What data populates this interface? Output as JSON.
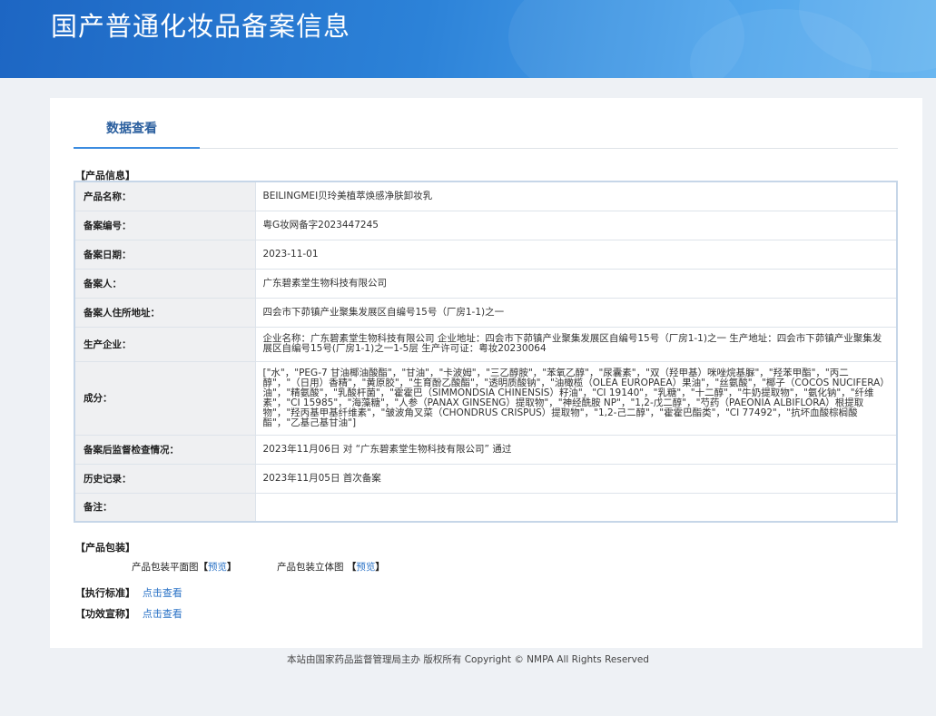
{
  "header": {
    "title": "国产普通化妆品备案信息"
  },
  "tabs": [
    {
      "label": "数据查看"
    }
  ],
  "product_info": {
    "section_title": "【产品信息】",
    "rows": [
      {
        "label": "产品名称：",
        "value": "BEILINGMEI贝玲美植萃焕感净肤卸妆乳"
      },
      {
        "label": "备案编号：",
        "value": "粤G妆网备字2023447245"
      },
      {
        "label": "备案日期：",
        "value": "2023-11-01"
      },
      {
        "label": "备案人：",
        "value": "广东碧素堂生物科技有限公司"
      },
      {
        "label": "备案人住所地址：",
        "value": "四会市下茆镇产业聚集发展区自编号15号（厂房1-1)之一"
      },
      {
        "label": "生产企业：",
        "value": "企业名称：广东碧素堂生物科技有限公司 企业地址：四会市下茆镇产业聚集发展区自编号15号（厂房1-1)之一 生产地址：四会市下茆镇产业聚集发展区自编号15号(厂房1-1)之一1-5层 生产许可证：粤妆20230064"
      },
      {
        "label": "成分：",
        "value": "[\"水\"，\"PEG-7 甘油椰油酸酯\"，\"甘油\"，\"卡波姆\"，\"三乙醇胺\"，\"苯氧乙醇\"，\"尿囊素\"，\"双（羟甲基）咪唑烷基脲\"，\"羟苯甲酯\"，\"丙二醇\"，\"（日用）香精\"，\"黄原胶\"，\"生育酚乙酸酯\"，\"透明质酸钠\"，\"油橄榄（OLEA EUROPAEA）果油\"，\"丝氨酸\"，\"椰子（COCOS NUCIFERA）油\"，\"精氨酸\"，\"乳酸杆菌\"，\"霍霍巴（SIMMONDSIA CHINENSIS）籽油\"，\"CI 19140\"，\"乳糖\"，\"十二醇\"，\"牛奶提取物\"，\"氨化钠\"，\"纤维素\"，\"CI 15985\"，\"海藻糖\"，\"人参（PANAX GINSENG）提取物\"，\"神经酰胺 NP\"，\"1,2-戊二醇\"，\"芍药（PAEONIA ALBIFLORA）根提取物\"，\"羟丙基甲基纤维素\"，\"皱波角叉菜（CHONDRUS CRISPUS）提取物\"，\"1,2-己二醇\"，\"霍霍巴酯类\"，\"CI 77492\"，\"抗坏血酸棕榈酸酯\"，\"乙基己基甘油\"]"
      },
      {
        "label": "备案后监督检查情况：",
        "value": "2023年11月06日 对 “广东碧素堂生物科技有限公司” 通过"
      },
      {
        "label": "历史记录：",
        "value": "2023年11月05日 首次备案"
      },
      {
        "label": "备注：",
        "value": ""
      }
    ]
  },
  "packaging": {
    "section_title": "【产品包装】",
    "flat_label": "产品包装平面图",
    "solid_label": "产品包装立体图",
    "bracket_open": "【",
    "bracket_close": "】",
    "preview_link": "预览"
  },
  "standard": {
    "label": "【执行标准】",
    "link": "点击查看"
  },
  "efficacy": {
    "label": "【功效宣称】",
    "link": "点击查看"
  },
  "footer": {
    "text": "本站由国家药品监督管理局主办 版权所有 Copyright © NMPA All Rights Reserved"
  }
}
